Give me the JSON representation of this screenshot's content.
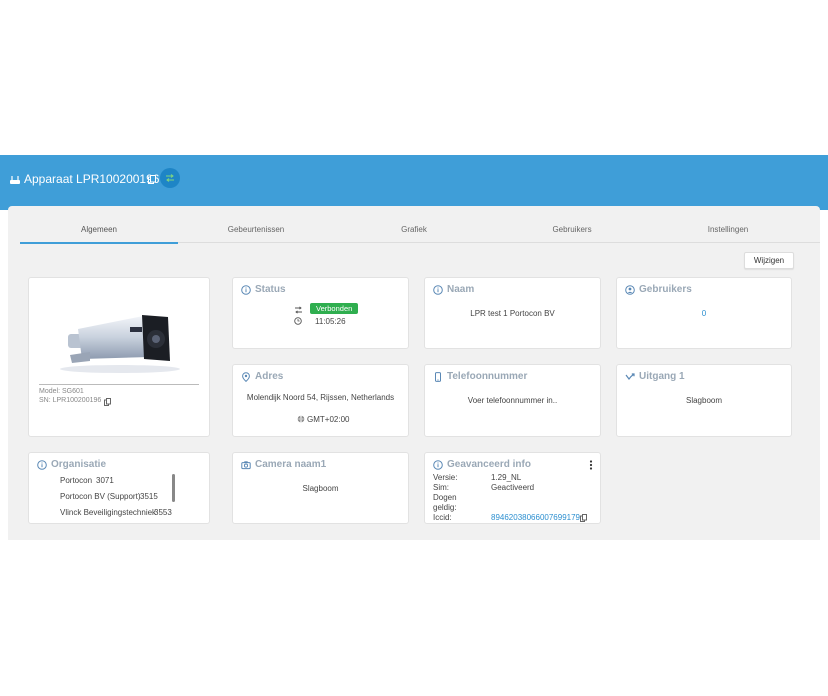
{
  "header": {
    "title": "Apparaat LPR100200196",
    "router_icon": "router-icon",
    "copy_icon": "copy-icon",
    "swap_icon": "swap-icon",
    "accent": "#3f9ed8"
  },
  "tabs": [
    {
      "label": "Algemeen",
      "active": true
    },
    {
      "label": "Gebeurtenissen",
      "active": false
    },
    {
      "label": "Grafiek",
      "active": false
    },
    {
      "label": "Gebruikers",
      "active": false
    },
    {
      "label": "Instellingen",
      "active": false
    }
  ],
  "actions": {
    "edit_label": "Wijzigen"
  },
  "device": {
    "model": "Model: SG601",
    "sn": "SN: LPR100200196"
  },
  "status": {
    "title": "Status",
    "badge": "Verbonden",
    "badge_color": "#2fae4f",
    "time": "11:05:26"
  },
  "naam": {
    "title": "Naam",
    "value": "LPR test 1 Portocon BV"
  },
  "gebruikers": {
    "title": "Gebruikers",
    "count": "0"
  },
  "adres": {
    "title": "Adres",
    "value": "Molendijk Noord 54, Rijssen, Netherlands",
    "timezone": "GMT+02:00"
  },
  "telefoon": {
    "title": "Telefoonnummer",
    "value": "Voer telefoonnummer in.."
  },
  "uitgang": {
    "title": "Uitgang 1",
    "value": "Slagboom"
  },
  "organisatie": {
    "title": "Organisatie",
    "items": [
      {
        "name": "Portocon",
        "id": "3071"
      },
      {
        "name": "Portocon BV (Support)",
        "id": "3515"
      },
      {
        "name": "Vlinck Beveiligingstechniek",
        "id": "3553"
      }
    ]
  },
  "camera": {
    "title": "Camera naam1",
    "value": "Slagboom"
  },
  "geavanceerd": {
    "title": "Geavanceerd info",
    "rows": [
      {
        "label": "Versie:",
        "value": "1.29_NL"
      },
      {
        "label": "Sim:",
        "value": "Geactiveerd"
      },
      {
        "label": "Dogen",
        "value": ""
      },
      {
        "label": "geldig:",
        "value": ""
      },
      {
        "label": "Iccid:",
        "value": "89462038066007699179"
      }
    ]
  }
}
